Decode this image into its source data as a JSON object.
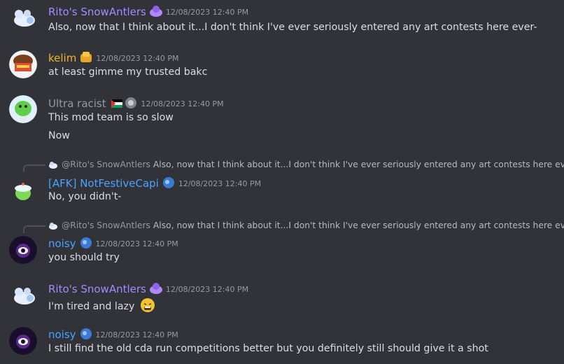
{
  "colors": {
    "background": "#313338",
    "rito": "#a38bff",
    "kelim": "#f0b232",
    "ultra": "#949ba4",
    "afk": "#4aa3ff",
    "noisy": "#4aa3ff"
  },
  "messages": [
    {
      "author": "Rito's SnowAntlers",
      "time": "12/08/2023 12:40 PM",
      "lines": [
        "Also, now that I think about it...I don't think I've ever seriously entered any art contests here ever-"
      ]
    },
    {
      "author": "kelim",
      "time": "12/08/2023 12:40 PM",
      "lines": [
        "at least gimme my trusted bakc"
      ]
    },
    {
      "author": "Ultra racist",
      "time": "12/08/2023 12:40 PM",
      "lines": [
        "This mod team is so slow",
        "Now"
      ]
    },
    {
      "author": "[AFK] NotFestiveCapi",
      "time": "12/08/2023 12:40 PM",
      "reply_to": "@Rito's SnowAntlers",
      "reply_text": "Also, now that I think about it...I don't think I've ever seriously entered any art contests here ever-",
      "lines": [
        "No, you didn't-"
      ]
    },
    {
      "author": "noisy",
      "time": "12/08/2023 12:40 PM",
      "reply_to": "@Rito's SnowAntlers",
      "reply_text": "Also, now that I think about it...I don't think I've ever seriously entered any art contests here ever-",
      "lines": [
        "you should try"
      ]
    },
    {
      "author": "Rito's SnowAntlers",
      "time": "12/08/2023 12:40 PM",
      "lines": [
        "I'm tired and lazy"
      ]
    },
    {
      "author": "noisy",
      "time": "12/08/2023 12:40 PM",
      "lines": [
        "I still find the old cda run competitions better but you definitely still should give it a shot"
      ]
    }
  ]
}
